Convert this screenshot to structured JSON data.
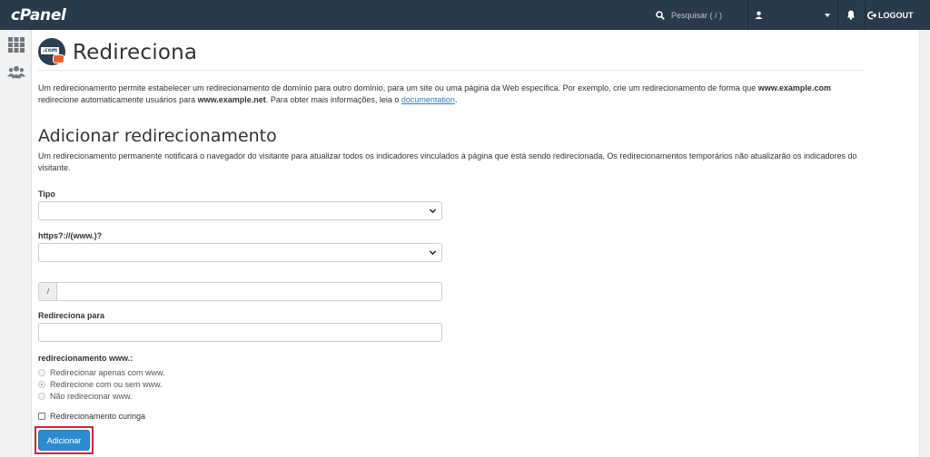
{
  "header": {
    "logo": "cPanel",
    "search_placeholder": "Pesquisar ( / )",
    "logout_label": "LOGOUT"
  },
  "page": {
    "title": "Redireciona",
    "icon_text": ".com",
    "intro_1": "Um redirecionamento permite estabelecer um redirecionamento de domínio para outro domínio, para um site ou uma página da Web específica. Por exemplo, crie um redirecionamento de forma que ",
    "intro_example_com": "www.example.com",
    "intro_2": " redirecione automaticamente usuários para ",
    "intro_example_net": "www.example.net",
    "intro_3": ". Para obter mais informações, leia o ",
    "intro_link": "documentation",
    "intro_4": "."
  },
  "section": {
    "title": "Adicionar redirecionamento",
    "description": "Um redirecionamento permanente notificará o navegador do visitante para atualizar todos os indicadores vinculados à página que está sendo redirecionada. Os redirecionamentos temporários não atualizarão os indicadores do visitante."
  },
  "form": {
    "tipo_label": "Tipo",
    "tipo_value": "",
    "domain_label": "https?://(www.)?",
    "domain_value": "",
    "path_prefix": "/",
    "path_value": "",
    "target_label": "Redireciona para",
    "target_value": "",
    "www_label": "redirecionamento www.:",
    "www_options": [
      "Redirecionar apenas com www.",
      "Redirecione com ou sem www.",
      "Não redirecionar www."
    ],
    "www_selected_index": 1,
    "wildcard_label": "Redirecionamento curinga",
    "submit_label": "Adicionar"
  },
  "colors": {
    "topbar": "#293a4a",
    "primary_button": "#2d8bd0",
    "highlight": "#c8283c",
    "link": "#337ab7"
  },
  "icons": [
    "search-icon",
    "user-icon",
    "caret-down-icon",
    "bell-icon",
    "logout-icon",
    "apps-grid-icon",
    "users-group-icon",
    "domain-com-icon",
    "chevron-down-icon"
  ]
}
